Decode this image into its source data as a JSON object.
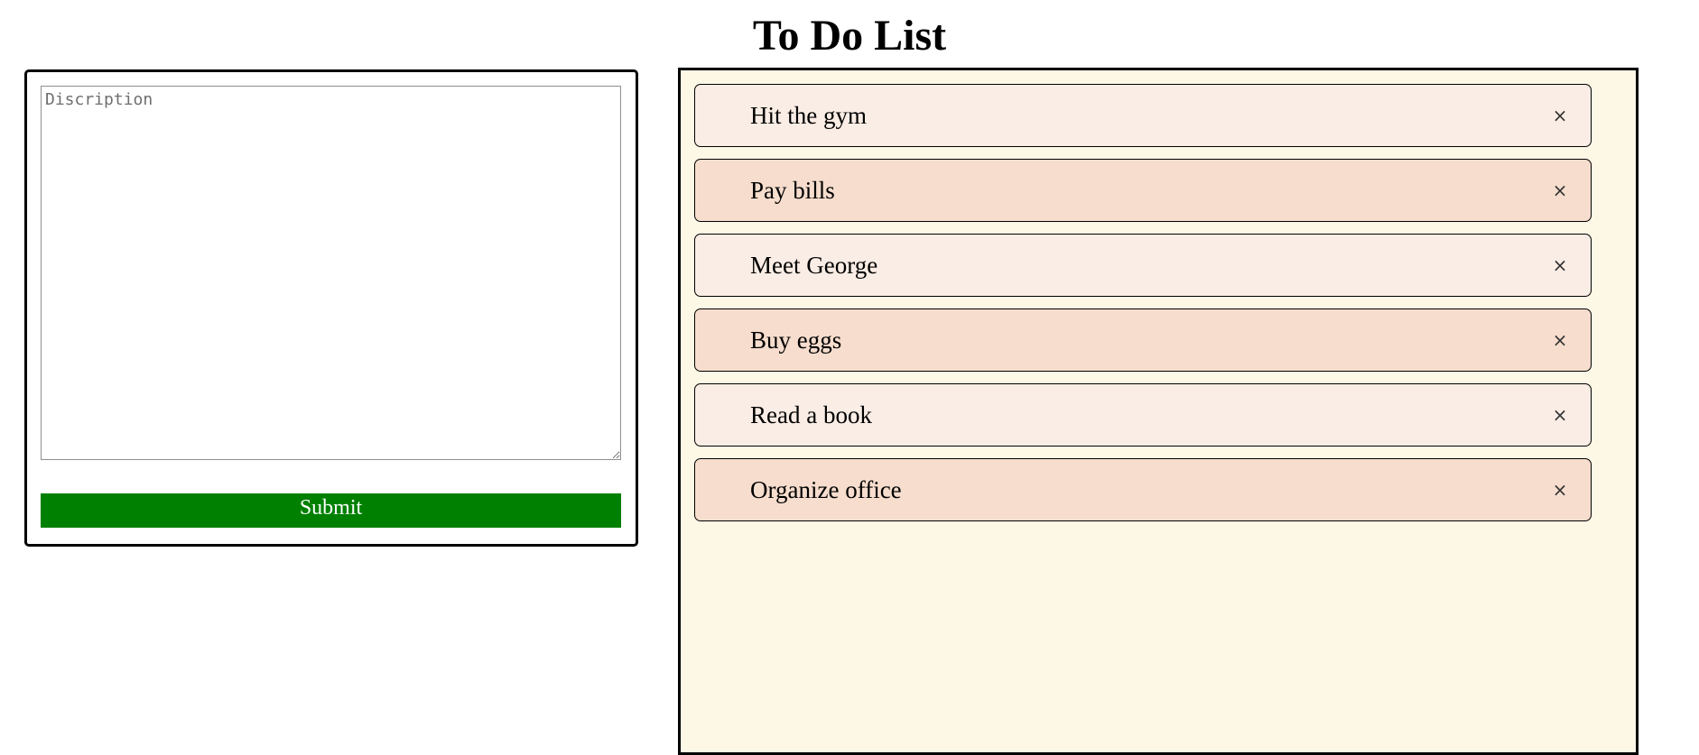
{
  "header": {
    "title": "To Do List"
  },
  "form": {
    "description_placeholder": "Discription",
    "description_value": "",
    "submit_label": "Submit",
    "submit_color": "#008000"
  },
  "todo": {
    "items": [
      {
        "label": "Hit the gym",
        "close_icon": "×"
      },
      {
        "label": "Pay bills",
        "close_icon": "×"
      },
      {
        "label": "Meet George",
        "close_icon": "×"
      },
      {
        "label": "Buy eggs",
        "close_icon": "×"
      },
      {
        "label": "Read a book",
        "close_icon": "×"
      },
      {
        "label": "Organize office",
        "close_icon": "×"
      }
    ],
    "colors": {
      "odd": "#faede5",
      "even": "#f6ddcd",
      "panel": "#fdf7e6"
    }
  }
}
